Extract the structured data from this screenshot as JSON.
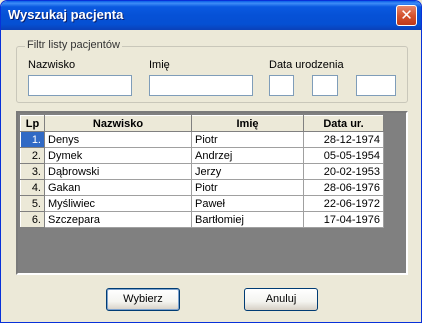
{
  "window": {
    "title": "Wyszukaj pacjenta",
    "close_glyph": "✕"
  },
  "filter": {
    "legend": "Filtr listy pacjentów",
    "surname_label": "Nazwisko",
    "firstname_label": "Imię",
    "birthdate_label": "Data urodzenia",
    "surname_value": "",
    "firstname_value": "",
    "birth_day": "",
    "birth_month": "",
    "birth_year": ""
  },
  "grid": {
    "columns": [
      "Lp",
      "Nazwisko",
      "Imię",
      "Data ur."
    ],
    "rows": [
      {
        "lp": "1.",
        "surname": "Denys",
        "firstname": "Piotr",
        "birthdate": "28-12-1974"
      },
      {
        "lp": "2.",
        "surname": "Dymek",
        "firstname": "Andrzej",
        "birthdate": "05-05-1954"
      },
      {
        "lp": "3.",
        "surname": "Dąbrowski",
        "firstname": "Jerzy",
        "birthdate": "20-02-1953"
      },
      {
        "lp": "4.",
        "surname": "Gakan",
        "firstname": "Piotr",
        "birthdate": "28-06-1976"
      },
      {
        "lp": "5.",
        "surname": "Myśliwiec",
        "firstname": "Paweł",
        "birthdate": "22-06-1972"
      },
      {
        "lp": "6.",
        "surname": "Szczepara",
        "firstname": "Bartłomiej",
        "birthdate": "17-04-1976"
      }
    ]
  },
  "buttons": {
    "select_label": "Wybierz",
    "cancel_label": "Anuluj"
  },
  "colors": {
    "titlebar": "#0A59E0",
    "selection": "#316AC5",
    "close": "#D4542F"
  }
}
